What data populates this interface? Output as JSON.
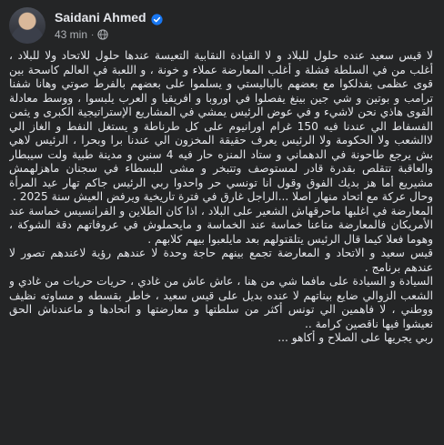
{
  "post": {
    "author": "Saidani Ahmed",
    "time": "43 min",
    "separator": "·",
    "icons": {
      "verified": "verified-badge-icon",
      "audience": "globe-icon"
    },
    "paragraphs": [
      "لا قيس سعيد عنده حلول للبلاد و لا القيادة النقابية التعيسة عندها حلول للاتحاد ولا للبلاد ، أغلب من في السلطة فشلة و أغلب المعارضة عملاء و خونة ، و اللعبة في العالم كاسحة بين قوى عظمى يفدلكوا مع بعضهم بالباليستي و يسلموا على بعضهم بالفرط صوتي وهانا شفنا ترامب و بوتين و شي جين بينغ يفصلوا في اوروبا و افريقيا و العرب يلبسوا ، ووسط معادلة القوى هاذي نحن لاشيء و في عوض الرئيس يمشي في المشاريع الإستراتيجية الكبرى و يثمن الفسفاط الي عندنا فيه 150 غرام اورانيوم على كل طرناطة و يستغل النفط و الغاز الي لاالشعب ولا الحكومة ولا الرئيس يعرف حقيقة المخزون الي عندنا برا وبحرا ، الرئيس لاهي بش يرجع طاحونة في الدهماني و ستاد المنزه حار فيه 4 سنين و مدينة طبية ولت سيبطار والعاقبة تتقلص بقدرة قادر لمستوصف وتتبخر و مشى للبسطاء في سجنان ماهزلهمش مشيريع أما هز بديك الفوق وقول انا تونسي حر واحدوا ربي الرئيس جاكم تهار عيد المرأة وحال عركة مع اتحاد منهار اصلا ...الراجل غارق في فترة تاريخية ويرفض العيش سنة 2025 .",
      "المعارضة في اغلبها ماحرقهاش الشعير على البلاد ، اذا كان الطلاين و الفرانسيس خماسة عند الأمريكان فالمعارضة متاعنا خماسة عند الخماسة و مايحملوش في عروفاتهم دقة الشوكة ، وهوما فعلا كيما قال الرئيس يتلقتولهم بعد مايلعبوا بيهم كلابهم .",
      "قيس سعيد و الاتحاد و المعارضة تجمع بينهم حاجة وحدة لا عندهم رؤية لاعندهم تصور لا عندهم برنامج .",
      "السيادة و السيادة على مافما شي من هنا ، عاش عاش من غادي ، حريات حريات من غادي و الشعب الزوالي ضايع بيناتهم لا عنده بديل على قيس سعيد ، خاطر بقسطه و مساوته نظيف ووطني ، لا فاهمين الي تونس أكثر من سلطتها و معارضتها و اتحادها و ماعندناش الحق نعيشوا فيها ناقصين كرامة ..",
      "ربي يجريها على الصلاح و أكاهو ..."
    ]
  }
}
